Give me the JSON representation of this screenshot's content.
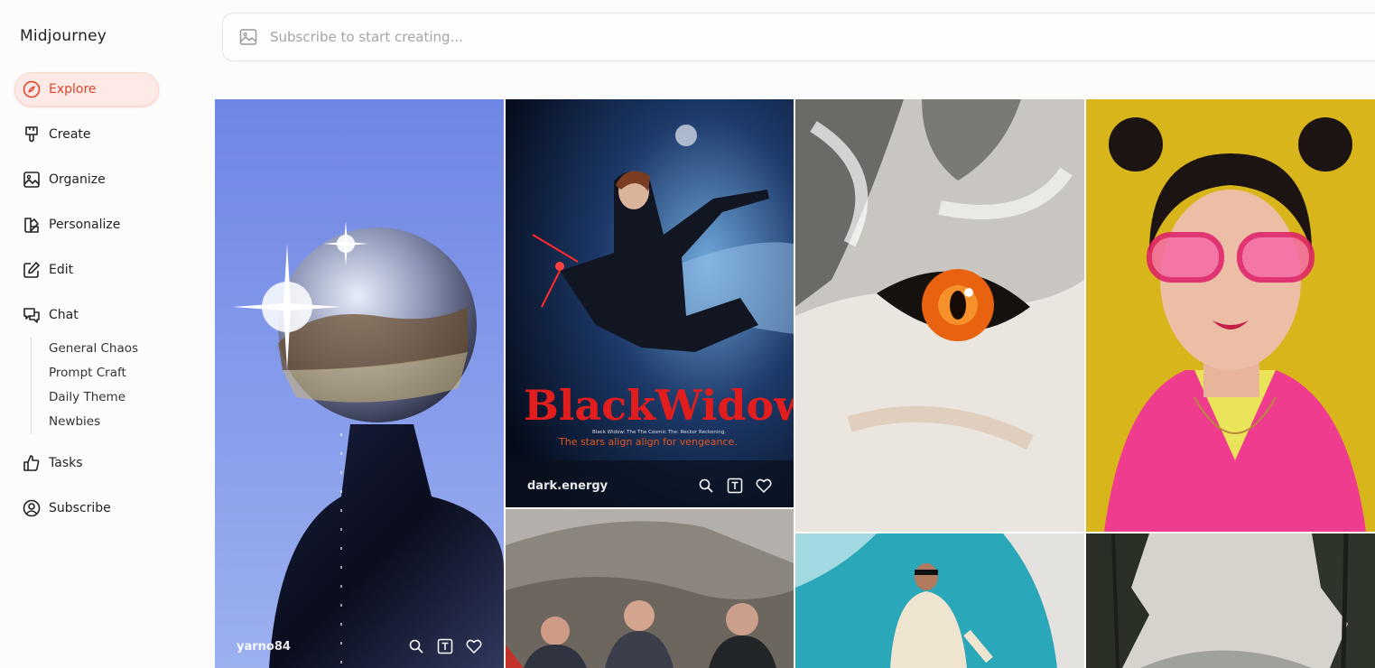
{
  "app": {
    "title": "Midjourney"
  },
  "nav": {
    "items": [
      {
        "label": "Explore",
        "icon": "compass-icon"
      },
      {
        "label": "Create",
        "icon": "brush-icon"
      },
      {
        "label": "Organize",
        "icon": "image-icon"
      },
      {
        "label": "Personalize",
        "icon": "palette-icon"
      },
      {
        "label": "Edit",
        "icon": "edit-icon"
      },
      {
        "label": "Chat",
        "icon": "chat-icon"
      },
      {
        "label": "Tasks",
        "icon": "thumbs-up-icon"
      },
      {
        "label": "Subscribe",
        "icon": "user-circle-icon"
      }
    ],
    "chat_rooms": [
      "General Chaos",
      "Prompt Craft",
      "Daily Theme",
      "Newbies"
    ]
  },
  "search": {
    "placeholder": "Subscribe to start creating..."
  },
  "gallery": {
    "tiles": [
      {
        "user": "yarno84",
        "subject": "chrome helmet figure"
      },
      {
        "user": "dark.energy",
        "subject": "Black Widow poster",
        "poster_title": "BlackWidow:",
        "poster_subtitle": "The stars align align for vengeance.",
        "poster_tag": "Black Widow: The The Cosmic The: Reckor Reckoning."
      },
      {
        "user": "",
        "subject": "painted wolf eye"
      },
      {
        "user": "",
        "subject": "pink jacket girl"
      },
      {
        "user": "",
        "subject": "mountain climbers"
      },
      {
        "user": "",
        "subject": "man in white suit"
      },
      {
        "user": "",
        "subject": "forest landscape"
      }
    ]
  },
  "colors": {
    "accent": "#e2452b",
    "active_bg": "#fde9e6"
  }
}
